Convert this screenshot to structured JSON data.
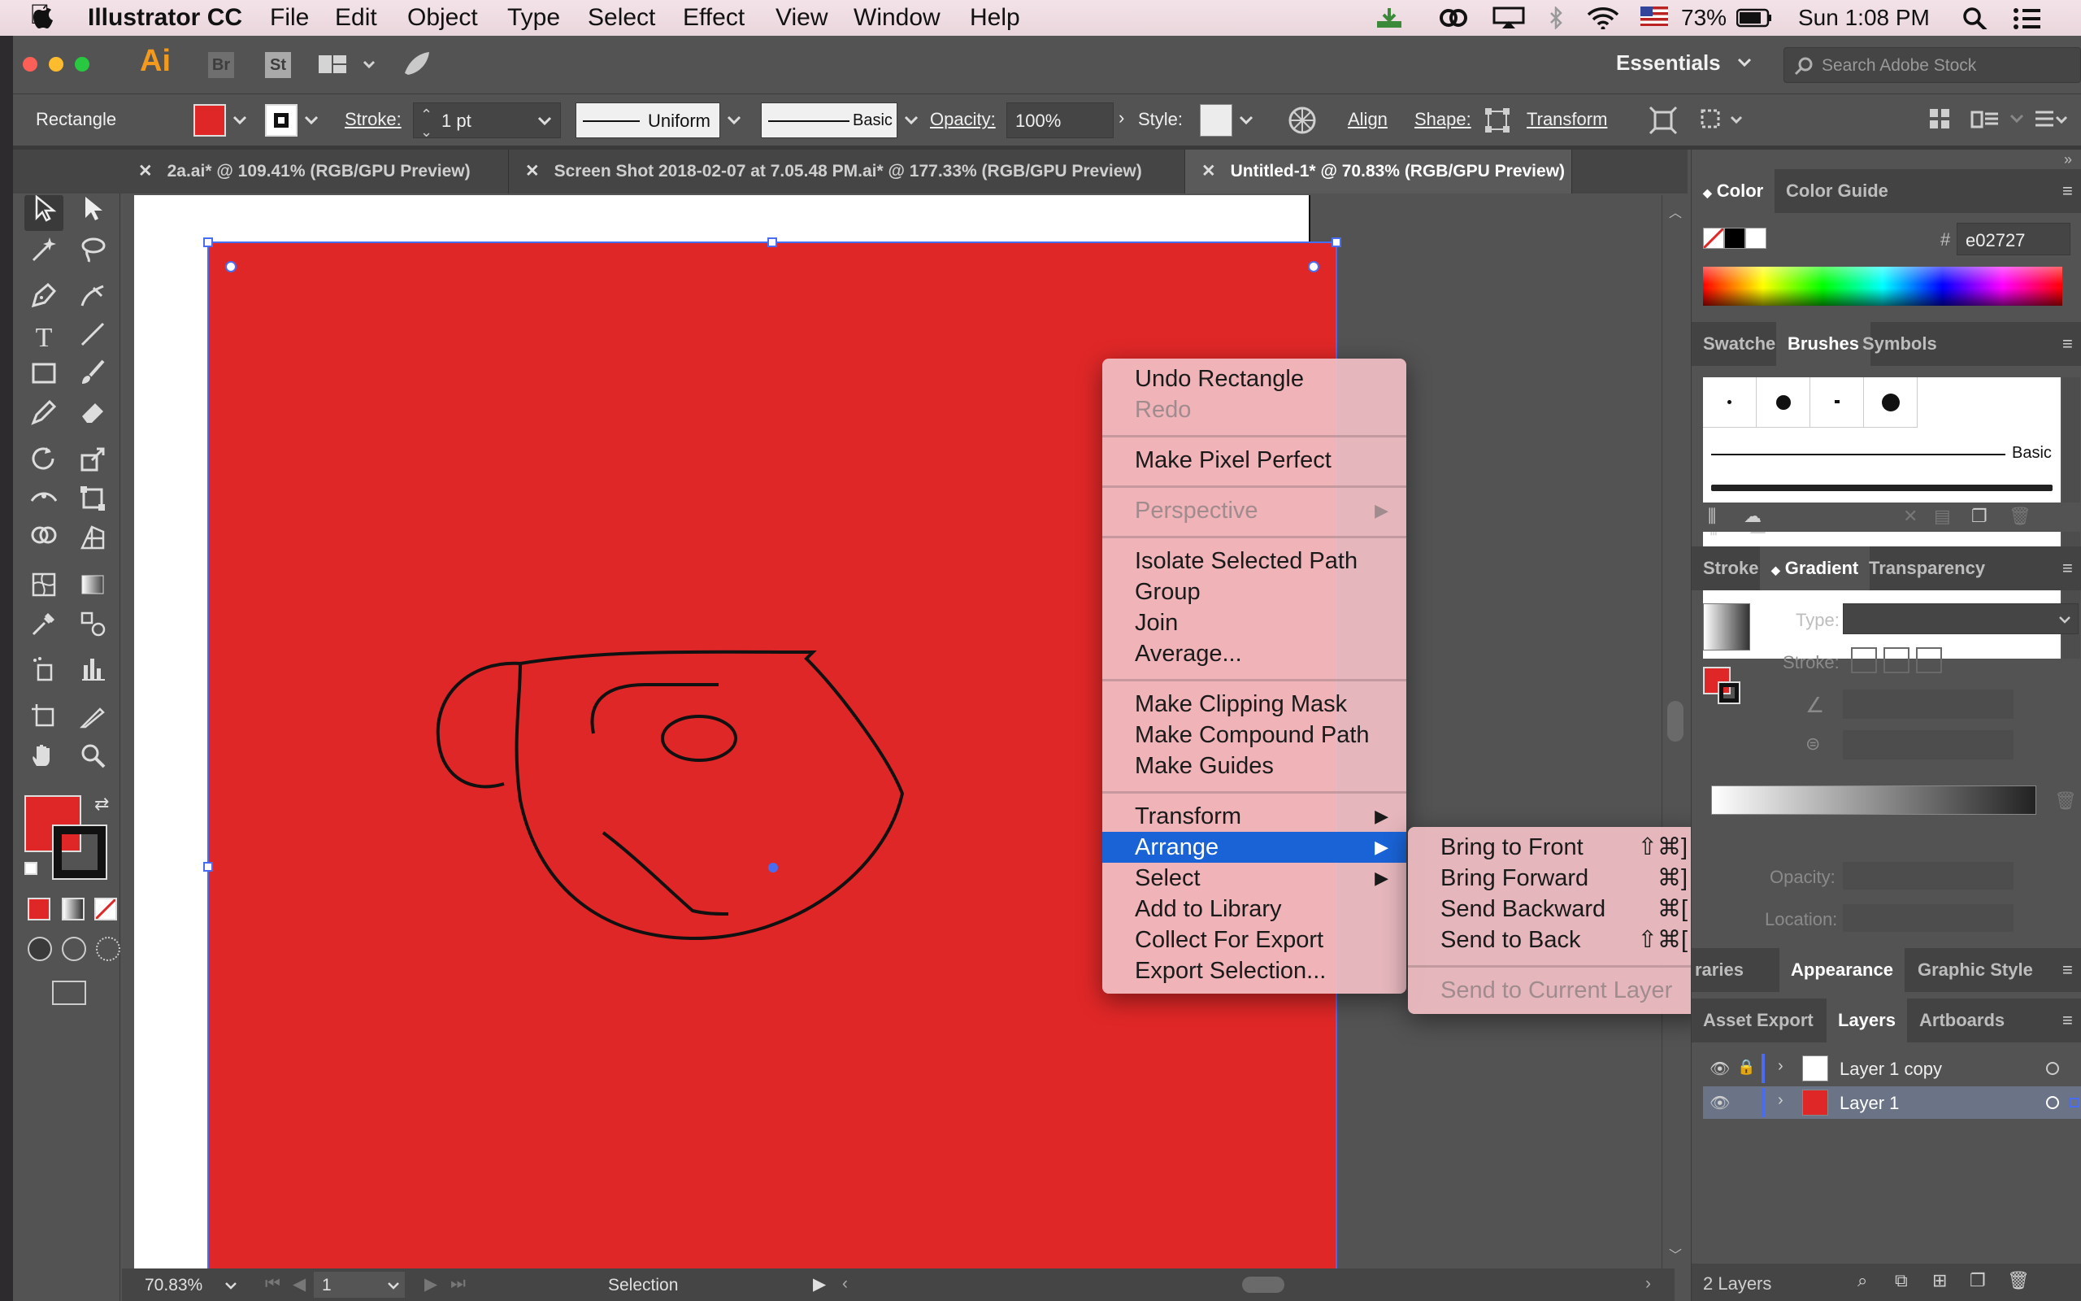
{
  "menubar": {
    "app_name": "Illustrator CC",
    "items": [
      "File",
      "Edit",
      "Object",
      "Type",
      "Select",
      "Effect",
      "View",
      "Window",
      "Help"
    ],
    "battery": "73%",
    "clock": "Sun 1:08 PM"
  },
  "appbar": {
    "logo": "Ai",
    "br": "Br",
    "st": "St",
    "workspace": "Essentials",
    "search_placeholder": "Search Adobe Stock"
  },
  "control": {
    "selection_label": "Rectangle",
    "stroke_label": "Stroke:",
    "stroke_value": "1 pt",
    "profile": "Uniform",
    "brush": "Basic",
    "opacity_label": "Opacity:",
    "opacity_value": "100%",
    "style_label": "Style:",
    "align": "Align",
    "shape": "Shape:",
    "transform": "Transform",
    "fill_color": "#e02727"
  },
  "tabs": [
    {
      "label": "2a.ai* @ 109.41% (RGB/GPU Preview)"
    },
    {
      "label": "Screen Shot 2018-02-07 at 7.05.48 PM.ai* @ 177.33% (RGB/GPU Preview)"
    },
    {
      "label": "Untitled-1* @ 70.83% (RGB/GPU Preview)"
    }
  ],
  "context_menu": {
    "items": [
      {
        "label": "Undo Rectangle",
        "enabled": true
      },
      {
        "label": "Redo",
        "enabled": false
      },
      {
        "label": "Make Pixel Perfect",
        "enabled": true
      },
      {
        "label": "Perspective",
        "enabled": false
      },
      {
        "label": "Isolate Selected Path",
        "enabled": true
      },
      {
        "label": "Group",
        "enabled": true
      },
      {
        "label": "Join",
        "enabled": true
      },
      {
        "label": "Average...",
        "enabled": true
      },
      {
        "label": "Make Clipping Mask",
        "enabled": true
      },
      {
        "label": "Make Compound Path",
        "enabled": true
      },
      {
        "label": "Make Guides",
        "enabled": true
      },
      {
        "label": "Transform",
        "enabled": true
      },
      {
        "label": "Arrange",
        "enabled": true,
        "highlighted": true
      },
      {
        "label": "Select",
        "enabled": true
      },
      {
        "label": "Add to Library",
        "enabled": true
      },
      {
        "label": "Collect For Export",
        "enabled": true
      },
      {
        "label": "Export Selection...",
        "enabled": true
      }
    ]
  },
  "arrange_submenu": {
    "items": [
      {
        "label": "Bring to Front",
        "shortcut": "⇧⌘]"
      },
      {
        "label": "Bring Forward",
        "shortcut": "⌘]"
      },
      {
        "label": "Send Backward",
        "shortcut": "⌘["
      },
      {
        "label": "Send to Back",
        "shortcut": "⇧⌘["
      },
      {
        "label": "Send to Current Layer",
        "shortcut": ""
      }
    ]
  },
  "panels": {
    "color_tab": "Color",
    "color_guide_tab": "Color Guide",
    "hex_label": "#",
    "hex_value": "e02727",
    "swatches_tab": "Swatches",
    "brushes_tab": "Brushes",
    "symbols_tab": "Symbols",
    "brush_basic": "Basic",
    "stroke_tab": "Stroke",
    "gradient_tab": "Gradient",
    "transparency_tab": "Transparency",
    "type_label": "Type:",
    "stroke_label": "Stroke:",
    "opacity_label": "Opacity:",
    "location_label": "Location:",
    "libraries_tab": "raries",
    "appearance_tab": "Appearance",
    "graphic_styles_tab": "Graphic Style",
    "asset_export_tab": "Asset Export",
    "layers_tab": "Layers",
    "artboards_tab": "Artboards",
    "layers": [
      {
        "name": "Layer 1 copy"
      },
      {
        "name": "Layer 1"
      }
    ],
    "layers_count": "2 Layers"
  },
  "status": {
    "zoom": "70.83%",
    "artboard": "1",
    "tool": "Selection"
  }
}
